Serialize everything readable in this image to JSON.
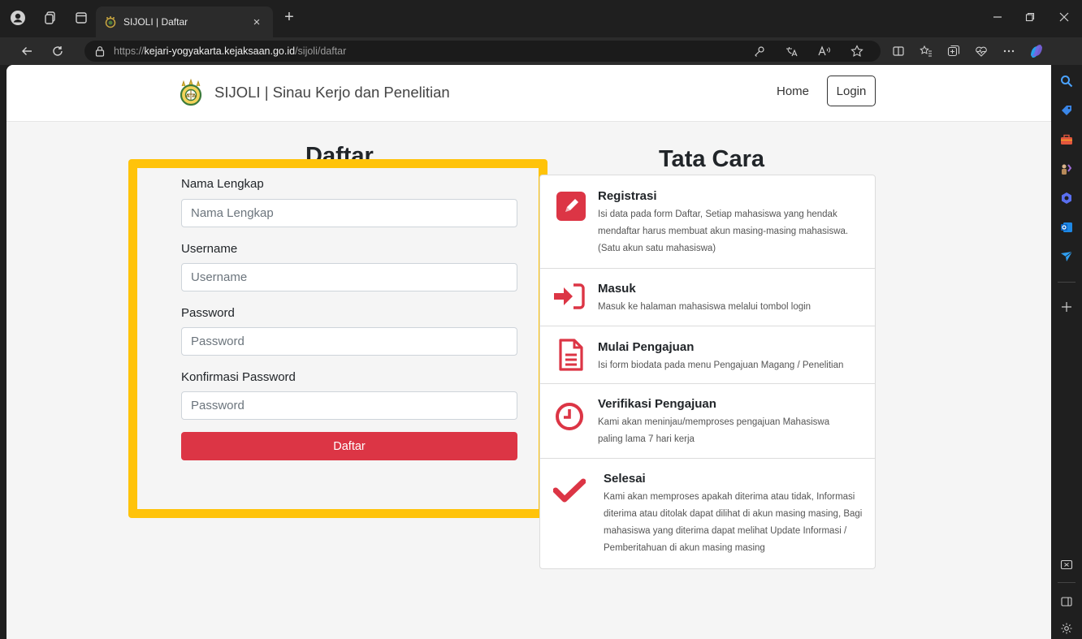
{
  "browser": {
    "tab_title": "SIJOLI | Daftar",
    "tab_close": "×",
    "new_tab": "+",
    "url_scheme": "https://",
    "url_host": "kejari-yogyakarta.kejaksaan.go.id",
    "url_path": "/sijoli/daftar"
  },
  "navbar": {
    "brand": "SIJOLI | Sinau Kerjo dan Penelitian",
    "home": "Home",
    "login": "Login"
  },
  "form": {
    "title": "Daftar",
    "fields": [
      {
        "label": "Nama Lengkap",
        "placeholder": "Nama Lengkap",
        "value": ""
      },
      {
        "label": "Username",
        "placeholder": "Username",
        "value": ""
      },
      {
        "label": "Password",
        "placeholder": "Password",
        "value": ""
      },
      {
        "label": "Konfirmasi Password",
        "placeholder": "Password",
        "value": ""
      }
    ],
    "submit": "Daftar"
  },
  "steps": {
    "title": "Tata Cara",
    "items": [
      {
        "title": "Registrasi",
        "desc": "Isi data pada form Daftar, Setiap mahasiswa yang hendak mendaftar harus membuat akun masing-masing mahasiswa. (Satu akun satu mahasiswa)",
        "icon": "pencil-square-icon"
      },
      {
        "title": "Masuk",
        "desc": "Masuk ke halaman mahasiswa melalui tombol login",
        "icon": "sign-in-icon"
      },
      {
        "title": "Mulai Pengajuan",
        "desc": "Isi form biodata pada menu Pengajuan Magang / Penelitian",
        "icon": "document-icon"
      },
      {
        "title": "Verifikasi Pengajuan",
        "desc": "Kami akan meninjau/memproses pengajuan Mahasiswa paling lama 7 hari kerja",
        "icon": "clock-icon"
      },
      {
        "title": "Selesai",
        "desc": "Kami akan memproses apakah diterima atau tidak, Informasi diterima atau ditolak dapat dilihat di akun masing masing, Bagi mahasiswa yang diterima dapat melihat Update Informasi / Pemberitahuan di akun masing masing",
        "icon": "check-icon"
      }
    ]
  },
  "colors": {
    "accent_red": "#dc3545",
    "highlight_yellow": "#ffc30a"
  }
}
